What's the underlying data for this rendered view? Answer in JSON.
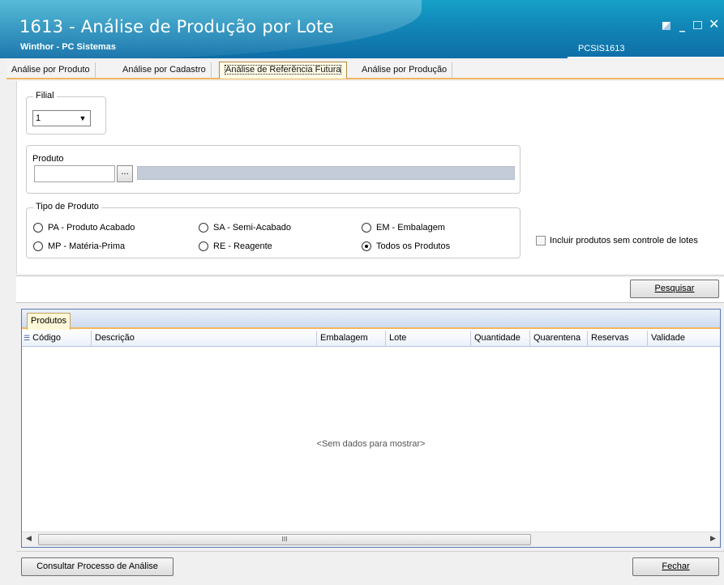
{
  "window": {
    "title": "1613 - Análise de Produção por Lote",
    "subtitle": "Winthor - PC Sistemas",
    "code": "PCSIS1613"
  },
  "tabs": [
    {
      "label": "Análise por Produto"
    },
    {
      "label": "Análise por Cadastro"
    },
    {
      "label": "Análise de Referência Futura"
    },
    {
      "label": "Análise por Produção"
    }
  ],
  "filial": {
    "legend": "Filial",
    "value": "1"
  },
  "produto": {
    "label": "Produto",
    "button_label": "...",
    "code_value": "",
    "description_value": ""
  },
  "tipo": {
    "legend": "Tipo de Produto",
    "options": [
      {
        "label": "PA - Produto Acabado",
        "selected": false
      },
      {
        "label": "SA - Semi-Acabado",
        "selected": false
      },
      {
        "label": "EM - Embalagem",
        "selected": false
      },
      {
        "label": "MP - Matéria-Prima",
        "selected": false
      },
      {
        "label": "RE - Reagente",
        "selected": false
      },
      {
        "label": "Todos os Produtos",
        "selected": true
      }
    ]
  },
  "checkbox": {
    "label": "Incluir produtos sem controle de lotes",
    "checked": false
  },
  "buttons": {
    "pesquisar": "Pesquisar",
    "consultar": "Consultar Processo de Análise",
    "fechar": "Fechar"
  },
  "grid": {
    "tab": "Produtos",
    "columns": [
      "Código",
      "Descrição",
      "Embalagem",
      "Lote",
      "Quantidade",
      "Quarentena",
      "Reservas",
      "Validade"
    ],
    "empty_text": "<Sem dados para mostrar>",
    "scroll_grip": "III"
  }
}
